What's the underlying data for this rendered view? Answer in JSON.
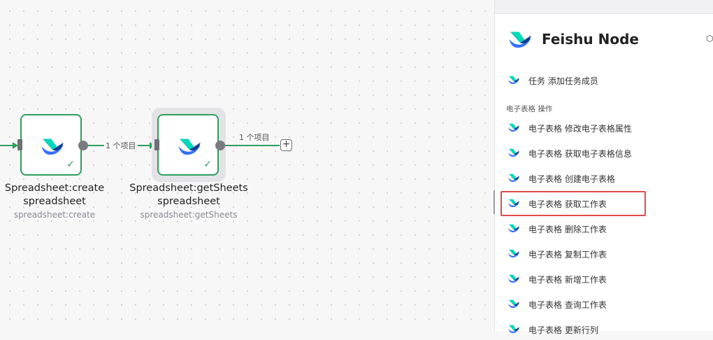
{
  "canvas": {
    "edges": [
      {
        "label": "1 个项目"
      },
      {
        "label": "1 个项目"
      }
    ],
    "nodes": [
      {
        "title_line1": "Spreadsheet:create",
        "title_line2": "spreadsheet",
        "subtitle": "spreadsheet:create",
        "status_icon": "check-icon"
      },
      {
        "title_line1": "Spreadsheet:getSheets",
        "title_line2": "spreadsheet",
        "subtitle": "spreadsheet:getSheets",
        "status_icon": "check-icon"
      }
    ],
    "add_button": "+"
  },
  "panel": {
    "title": "Feishu Node",
    "task_item": "任务 添加任务成员",
    "section_label": "电子表格 操作",
    "items": [
      "电子表格 修改电子表格属性",
      "电子表格 获取电子表格信息",
      "电子表格 创建电子表格",
      "电子表格 获取工作表",
      "电子表格 删除工作表",
      "电子表格 复制工作表",
      "电子表格 新增工作表",
      "电子表格 查询工作表",
      "电子表格 更新行列"
    ],
    "highlighted_index": 3
  },
  "colors": {
    "success_green": "#2f9e5b",
    "highlight_red": "#e04b4b",
    "feishu_blue": "#3370ff",
    "feishu_teal": "#00d6b9",
    "feishu_navy": "#133c9a"
  }
}
